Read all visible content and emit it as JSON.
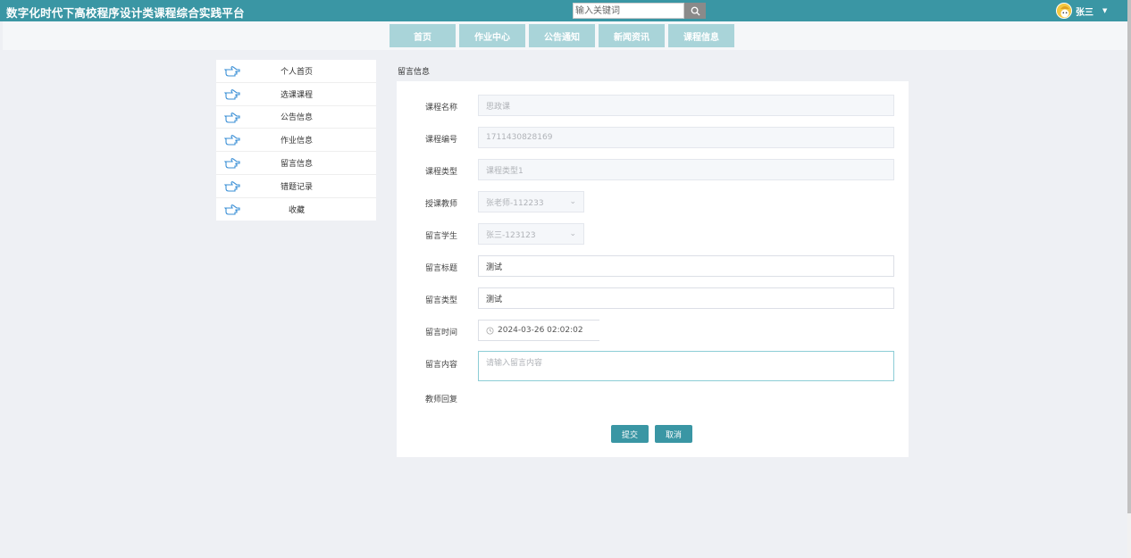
{
  "header": {
    "title": "数字化时代下高校程序设计类课程综合实践平台",
    "search_placeholder": "输入关键词",
    "user_name": "张三"
  },
  "nav": {
    "items": [
      {
        "label": "首页"
      },
      {
        "label": "作业中心"
      },
      {
        "label": "公告通知"
      },
      {
        "label": "新闻资讯"
      },
      {
        "label": "课程信息"
      }
    ]
  },
  "sidebar": {
    "items": [
      {
        "label": "个人首页"
      },
      {
        "label": "选课课程"
      },
      {
        "label": "公告信息"
      },
      {
        "label": "作业信息"
      },
      {
        "label": "留言信息"
      },
      {
        "label": "错题记录"
      },
      {
        "label": "收藏"
      }
    ]
  },
  "main": {
    "section_title": "留言信息",
    "fields": {
      "course_name": {
        "label": "课程名称",
        "value": "思政课"
      },
      "course_code": {
        "label": "课程编号",
        "value": "1711430828169"
      },
      "course_type": {
        "label": "课程类型",
        "value": "课程类型1"
      },
      "teacher": {
        "label": "授课教师",
        "value": "张老师-112233"
      },
      "student": {
        "label": "留言学生",
        "value": "张三-123123"
      },
      "msg_title": {
        "label": "留言标题",
        "value": "测试"
      },
      "msg_type": {
        "label": "留言类型",
        "value": "测试"
      },
      "msg_time": {
        "label": "留言时间",
        "value": "2024-03-26 02:02:02"
      },
      "msg_content": {
        "label": "留言内容",
        "placeholder": "请输入留言内容"
      },
      "teacher_reply": {
        "label": "教师回复"
      }
    },
    "buttons": {
      "submit": "提交",
      "cancel": "取消"
    }
  },
  "colors": {
    "accent": "#3a96a4",
    "nav_item_bg": "#a9d4d9",
    "page_bg": "#eef0f4"
  },
  "icons": {
    "search": "search-icon",
    "sidebar_item": "pointing-hand-icon",
    "dropdown": "chevron-down-icon",
    "clock": "clock-icon"
  }
}
